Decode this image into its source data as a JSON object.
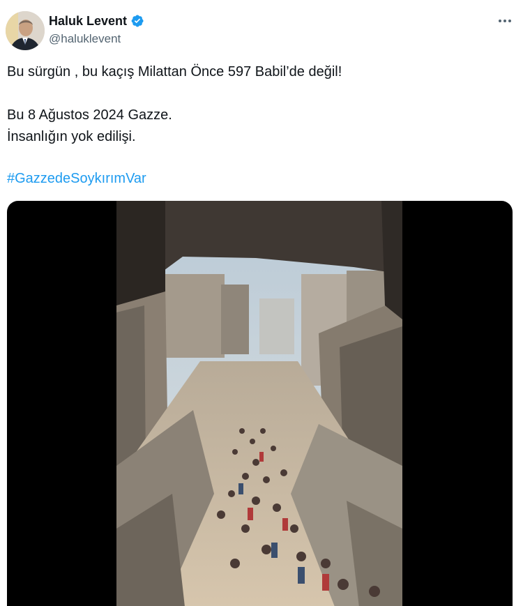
{
  "author": {
    "name": "Haluk Levent",
    "handle": "@haluklevent",
    "verified": true,
    "avatar_icon": "avatar-photo-icon"
  },
  "tweet": {
    "line1": "Bu sürgün , bu kaçış Milattan Önce 597 Babil’de değil!",
    "line2": "Bu 8 Ağustos 2024 Gazze.",
    "line3": "İnsanlığın yok edilişi.",
    "hashtag": "#GazzedeSoykırımVar"
  },
  "colors": {
    "accent": "#1d9bf0",
    "text": "#0f1419",
    "secondary": "#536471",
    "media_background": "#000000"
  },
  "icons": {
    "verified": "verified-badge-icon",
    "more": "more-options-icon"
  }
}
